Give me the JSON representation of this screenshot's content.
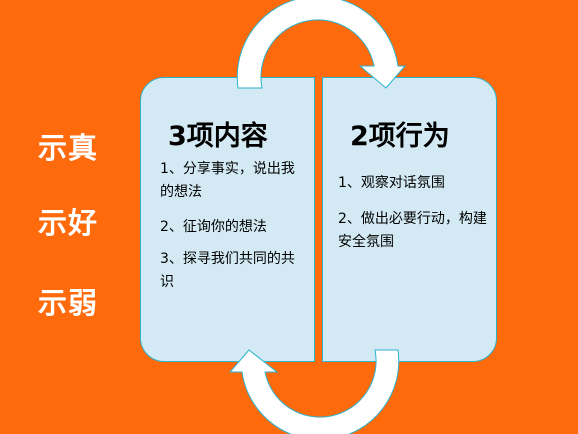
{
  "side_labels": [
    "示真",
    "示好",
    "示弱"
  ],
  "left_panel": {
    "title": "3项内容",
    "items": [
      "1、分享事实，说出我的想法",
      "2、征询你的想法",
      "3、探寻我们共同的共识"
    ]
  },
  "right_panel": {
    "title": "2项行为",
    "items": [
      "1、观察对话氛围",
      "2、做出必要行动，构建安全氛围"
    ]
  },
  "colors": {
    "background": "#FF6A0C",
    "panel": "#D3EAF4",
    "border": "#2BB3CC"
  }
}
